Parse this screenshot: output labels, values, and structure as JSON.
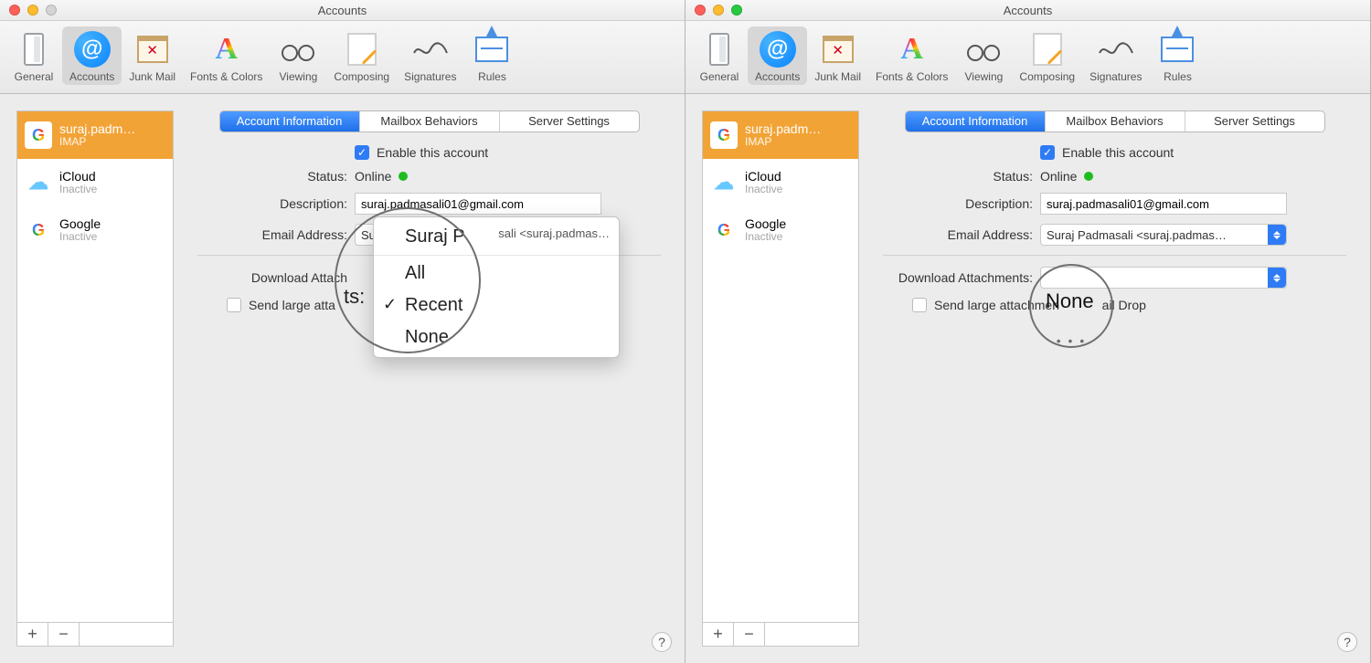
{
  "window_title": "Accounts",
  "toolbar": [
    {
      "label": "General"
    },
    {
      "label": "Accounts"
    },
    {
      "label": "Junk Mail"
    },
    {
      "label": "Fonts & Colors"
    },
    {
      "label": "Viewing"
    },
    {
      "label": "Composing"
    },
    {
      "label": "Signatures"
    },
    {
      "label": "Rules"
    }
  ],
  "accounts_icon_glyph": "@",
  "sidebar": {
    "items": [
      {
        "name": "suraj.padm…",
        "sub": "IMAP",
        "selected": true,
        "icon": "G"
      },
      {
        "name": "iCloud",
        "sub": "Inactive",
        "icon": "cloud"
      },
      {
        "name": "Google",
        "sub": "Inactive",
        "icon": "G"
      }
    ],
    "add": "+",
    "remove": "−"
  },
  "tabs": {
    "info": "Account Information",
    "mailbox": "Mailbox Behaviors",
    "server": "Server Settings"
  },
  "form": {
    "enable_label": "Enable this account",
    "status_label": "Status:",
    "status_value": "Online",
    "description_label": "Description:",
    "description_value": "suraj.padmasali01@gmail.com",
    "email_label": "Email Address:",
    "email_value": "Suraj Padmasali <suraj.padmas…",
    "download_label_left": "Download Attach",
    "download_label_right": "Download Attachments:",
    "maildrop_left": "Send large atta",
    "maildrop_right": "Send large attachmen            ail Drop",
    "download_value_right": "None",
    "help": "?"
  },
  "dropdown": {
    "head": "Suraj P",
    "sali_frag": "sali <suraj.padmas…",
    "ts_frag": "ts:",
    "options": [
      "All",
      "Recent",
      "None"
    ],
    "selected": "Recent"
  }
}
